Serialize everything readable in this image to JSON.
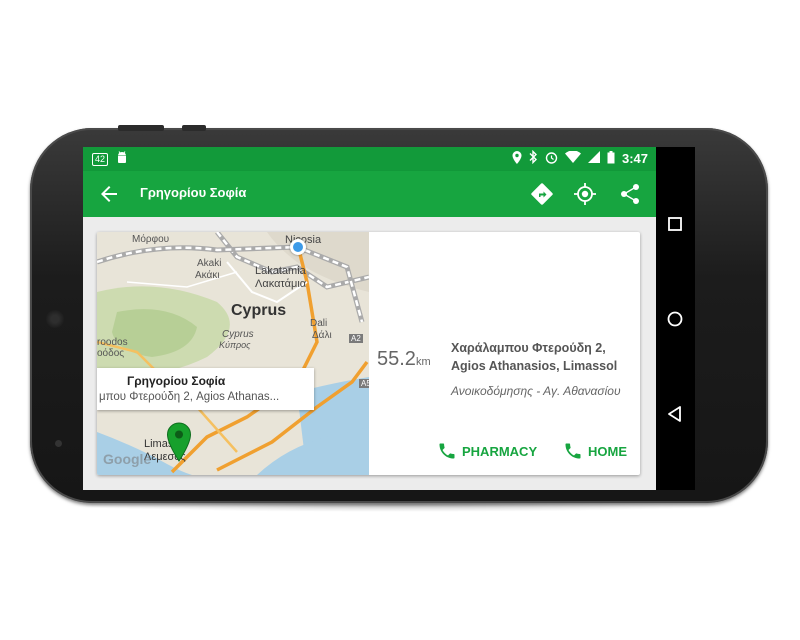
{
  "status_bar": {
    "badge": "42",
    "time": "3:47",
    "icons": [
      "notification-42-icon",
      "android-icon",
      "location-icon",
      "bluetooth-icon",
      "alarm-icon",
      "wifi-icon",
      "signal-icon",
      "battery-icon"
    ]
  },
  "app_bar": {
    "title": "Γρηγορίου Σοφία",
    "actions": [
      "directions-icon",
      "my-location-icon",
      "share-icon"
    ]
  },
  "map": {
    "labels": {
      "morfou": "Μόρφου",
      "nicosia": "Nicosia",
      "akaki_latin": "Akaki",
      "akaki_greek": "Ακάκι",
      "lakatamia_latin": "Lakatamia",
      "lakatamia_greek": "Λακατάμια",
      "cyprus_latin": "Cyprus",
      "cyprus_italic": "Cyprus",
      "cyprus_greek": "Κύπρος",
      "dali": "Dali",
      "dali_greek": "Δάλι",
      "troodos_latin": "roodos",
      "troodos_greek": "οόδος",
      "a2": "A2",
      "a5": "A5",
      "limassol_latin": "Limassol",
      "limassol_greek": "Λεμεσός",
      "google": "Google"
    },
    "info_window": {
      "title": "Γρηγορίου Σοφία",
      "address": "μπου Φτερούδη 2, Agios Athanas..."
    }
  },
  "details": {
    "distance_value": "55.2",
    "distance_unit": "km",
    "address": "Χαράλαμπου Φτερούδη 2, Agios Athanasios, Limassol",
    "area": "Ανοικοδόμησης - Αγ. Αθανασίου",
    "pharmacy_label": "PHARMACY",
    "home_label": "HOME"
  },
  "colors": {
    "primary": "#17a540",
    "status_bar": "#129a3a",
    "accent_green": "#17a540"
  }
}
